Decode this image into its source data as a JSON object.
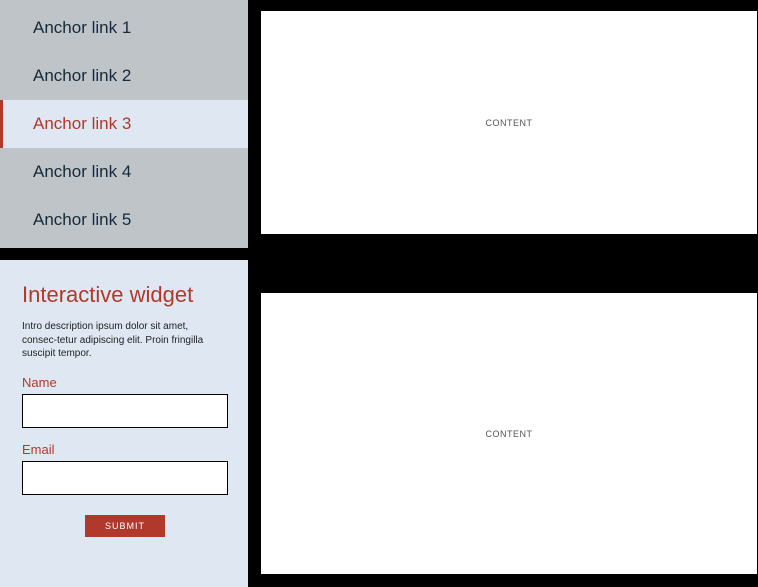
{
  "nav": {
    "items": [
      {
        "label": "Anchor link 1",
        "active": false
      },
      {
        "label": "Anchor link 2",
        "active": false
      },
      {
        "label": "Anchor link 3",
        "active": true
      },
      {
        "label": "Anchor link 4",
        "active": false
      },
      {
        "label": "Anchor link 5",
        "active": false
      }
    ]
  },
  "widget": {
    "title": "Interactive widget",
    "description": "Intro description ipsum dolor sit amet, consec-tetur adipiscing elit. Proin fringilla suscipit tempor.",
    "name_label": "Name",
    "name_value": "",
    "email_label": "Email",
    "email_value": "",
    "submit_label": "SUBMIT"
  },
  "content": {
    "top_label": "CONTENT",
    "bottom_label": "CONTENT"
  }
}
